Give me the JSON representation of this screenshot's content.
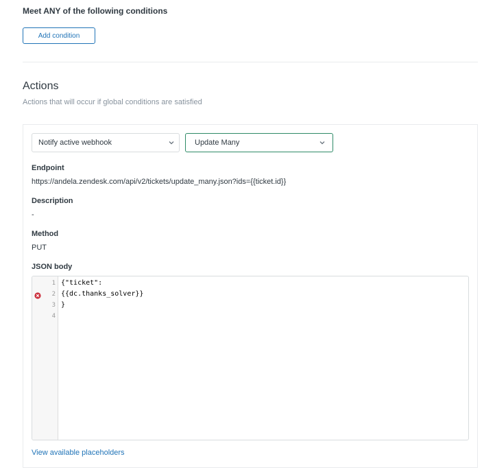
{
  "conditions": {
    "title": "Meet ANY of the following conditions",
    "add_button": "Add condition"
  },
  "actions": {
    "title": "Actions",
    "subtitle": "Actions that will occur if global conditions are satisfied",
    "action_select": {
      "value": "Notify active webhook"
    },
    "secondary_select": {
      "value": "Update Many"
    },
    "endpoint": {
      "label": "Endpoint",
      "value": "https://andela.zendesk.com/api/v2/tickets/update_many.json?ids={{ticket.id}}"
    },
    "description": {
      "label": "Description",
      "value": "-"
    },
    "method": {
      "label": "Method",
      "value": "PUT"
    },
    "json_body": {
      "label": "JSON body",
      "lines": [
        {
          "number": "1",
          "text": "{\"ticket\":",
          "error": false
        },
        {
          "number": "2",
          "text": "{{dc.thanks_solver}}",
          "error": true
        },
        {
          "number": "3",
          "text": "}",
          "error": false
        },
        {
          "number": "4",
          "text": "",
          "error": false
        }
      ]
    },
    "placeholders_link": "View available placeholders"
  },
  "colors": {
    "accent": "#1f73b7",
    "error": "#cc3340",
    "selected_border": "#2d8a66"
  },
  "icons": [
    "chevron-down-icon",
    "error-icon"
  ]
}
